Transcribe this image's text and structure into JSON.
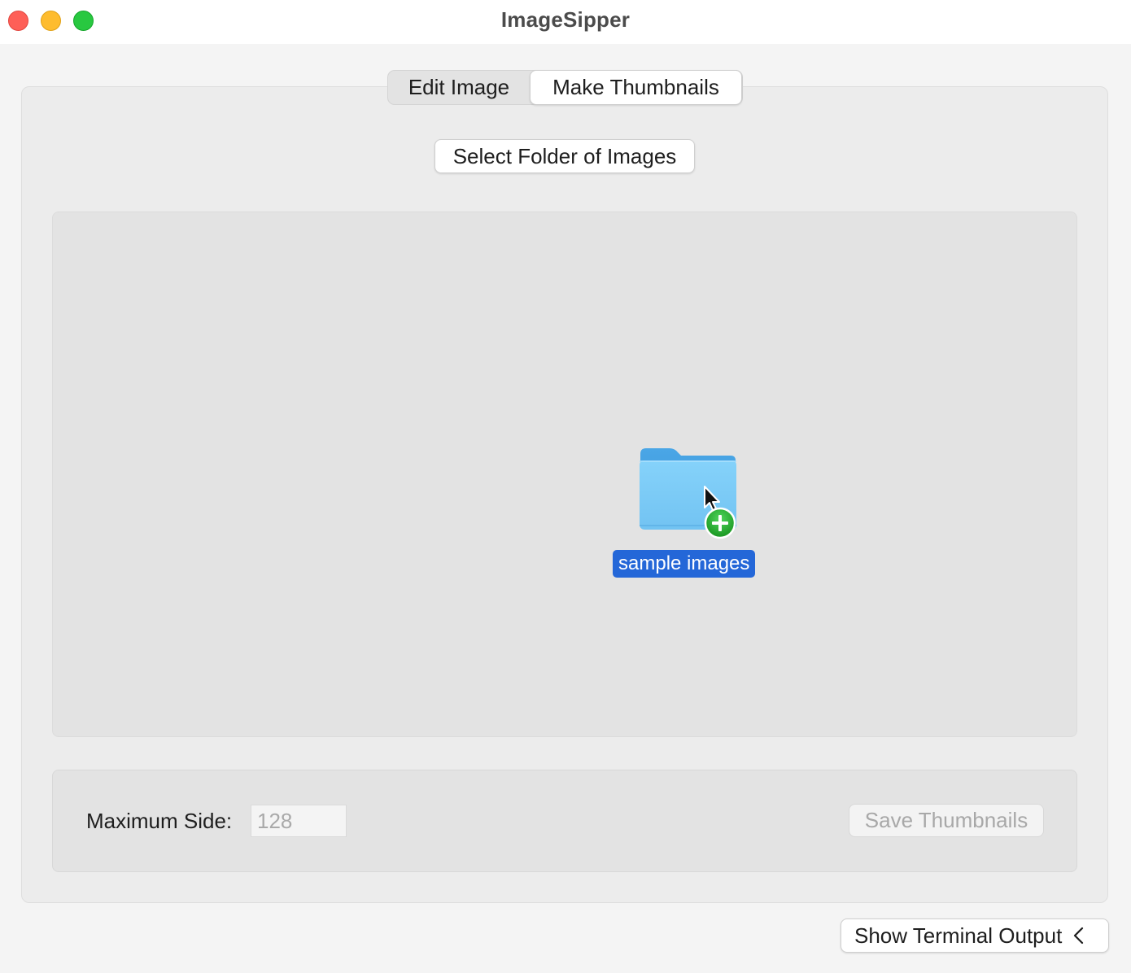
{
  "window": {
    "title": "ImageSipper"
  },
  "tabs": [
    {
      "label": "Edit Image",
      "selected": false
    },
    {
      "label": "Make Thumbnails",
      "selected": true
    }
  ],
  "toolbar": {
    "select_folder_label": "Select Folder of Images"
  },
  "drop_area": {
    "dragged_item_label": "sample images",
    "dragged_item_icon": "folder-icon",
    "badge_icon": "plus-badge-icon",
    "cursor_icon": "arrow-cursor-icon",
    "selection_color": "#2467d8"
  },
  "options": {
    "max_side_label": "Maximum Side:",
    "max_side_placeholder": "128",
    "save_label": "Save Thumbnails",
    "save_enabled": false
  },
  "footer": {
    "terminal_label": "Show Terminal Output",
    "terminal_icon": "chevron-left-icon"
  }
}
